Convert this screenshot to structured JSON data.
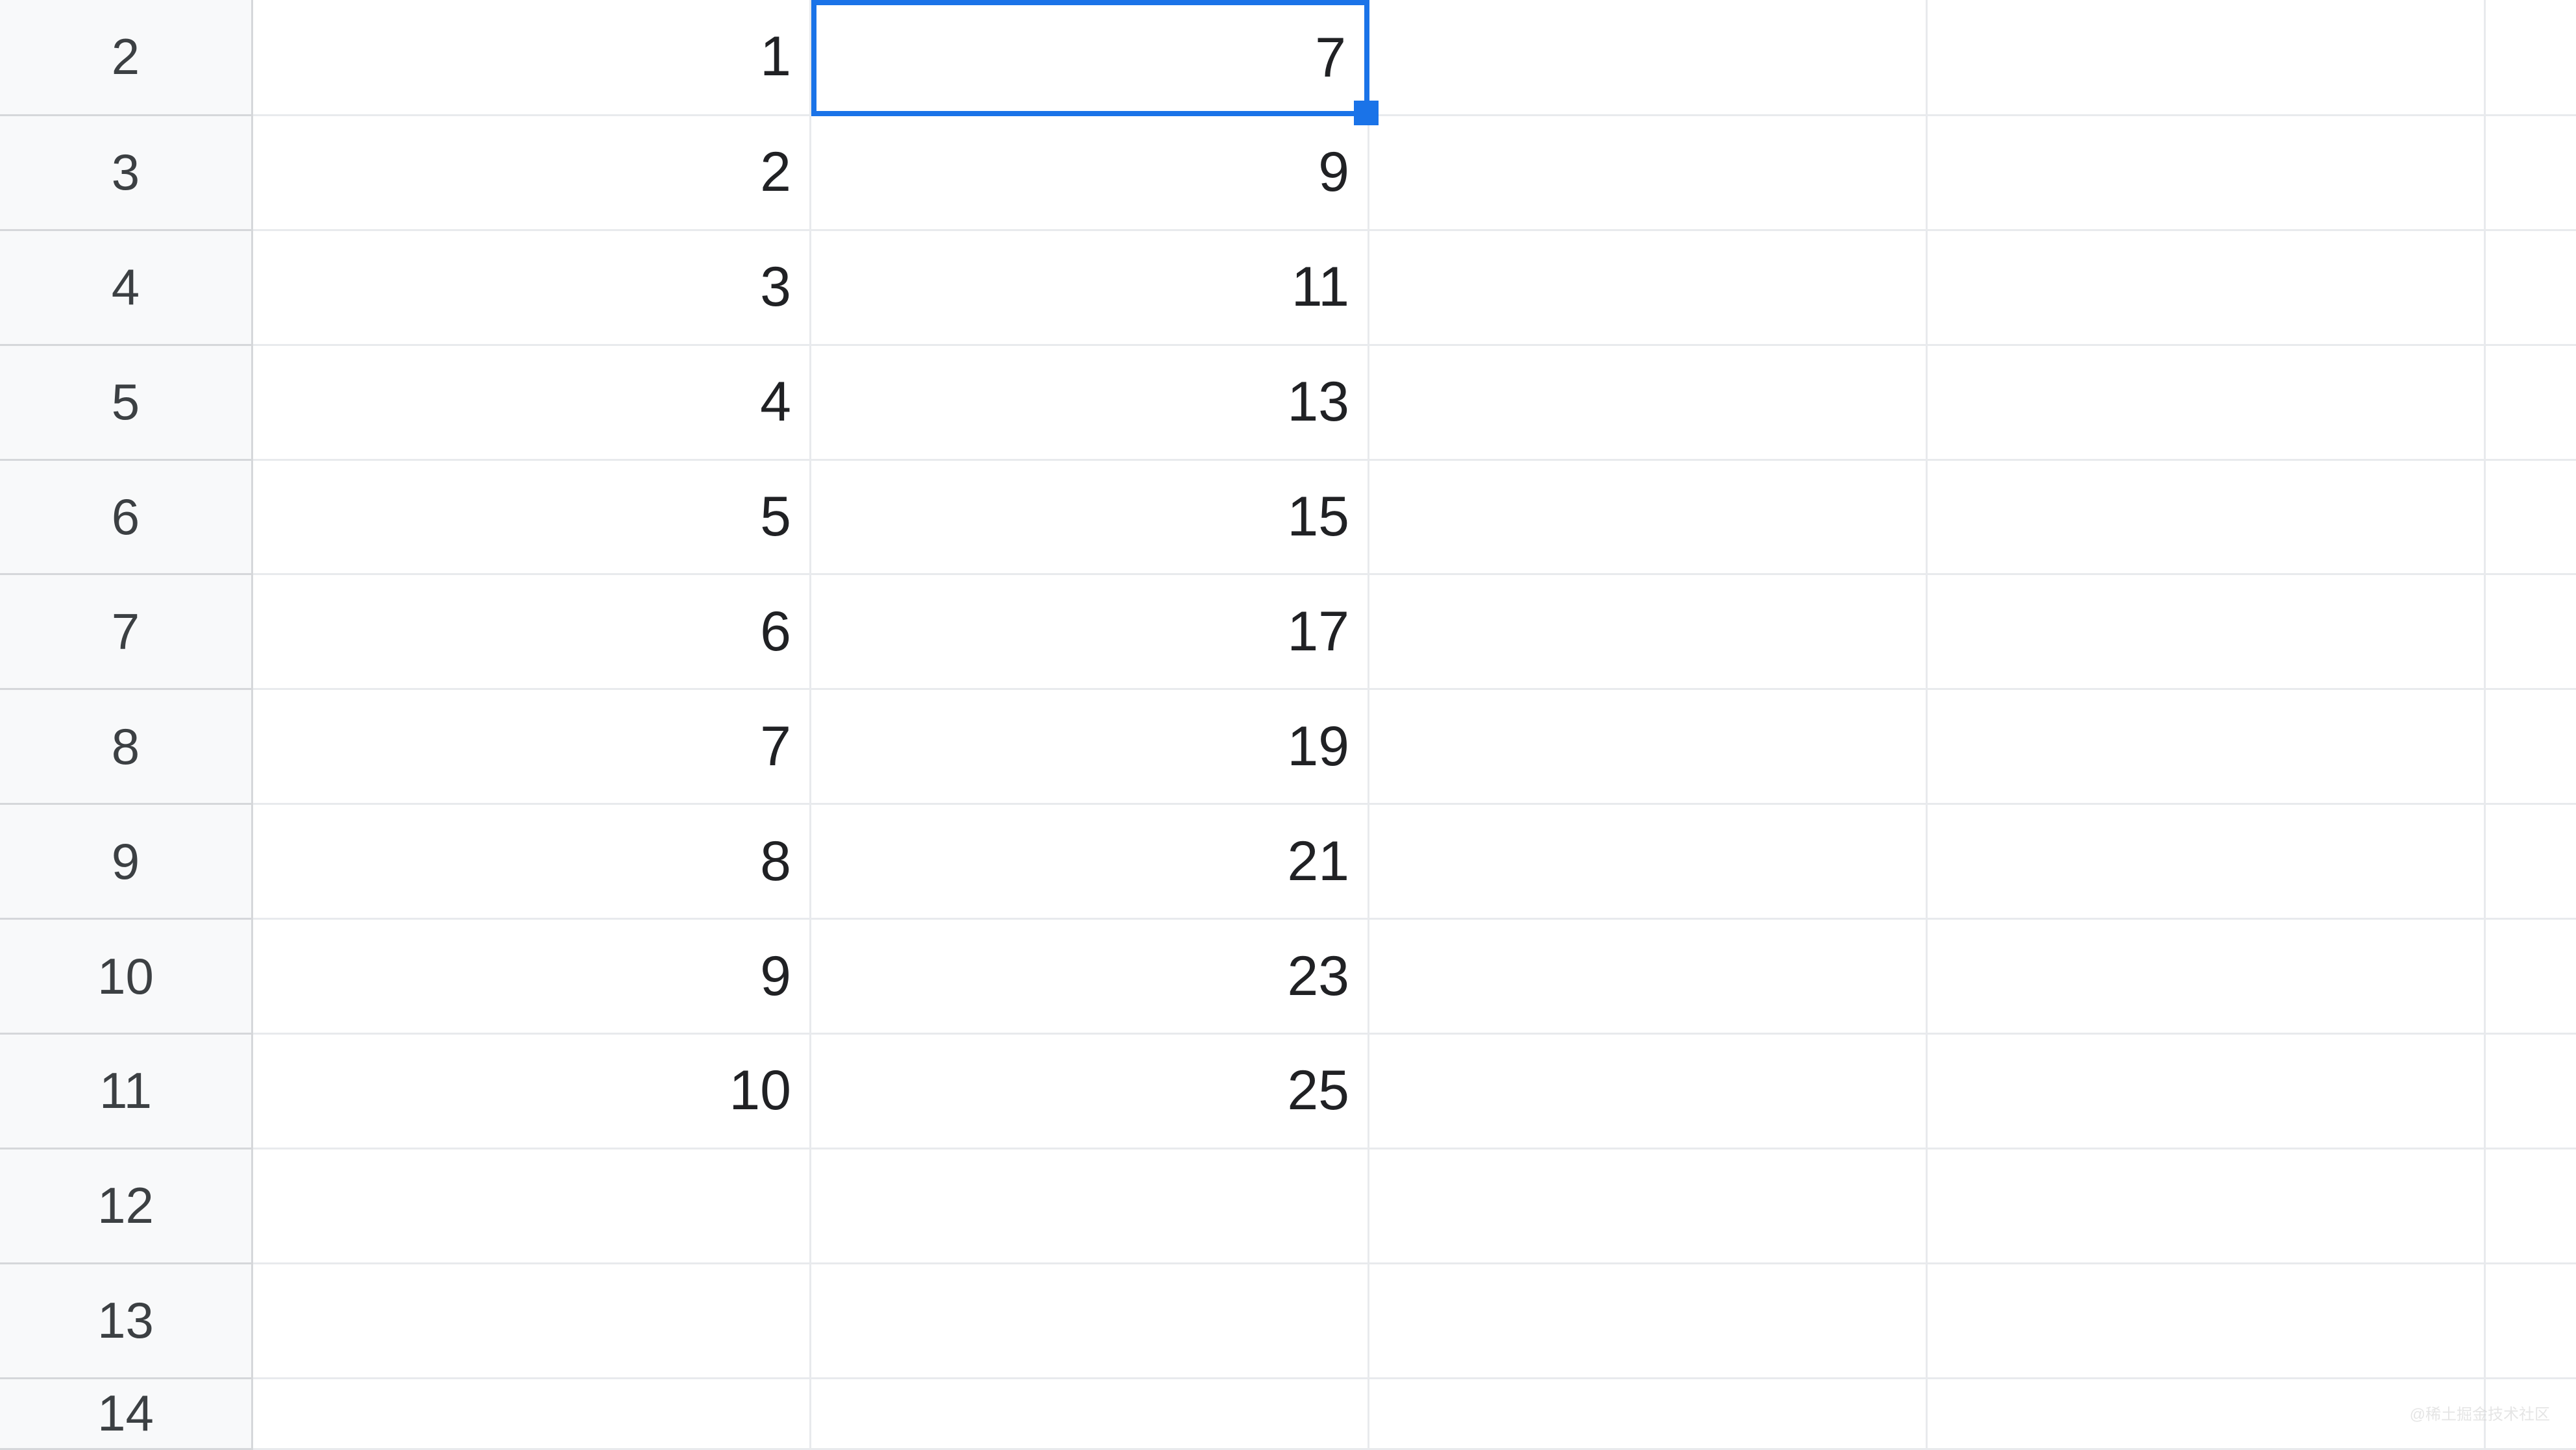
{
  "rowHeaders": [
    "2",
    "3",
    "4",
    "5",
    "6",
    "7",
    "8",
    "9",
    "10",
    "11",
    "12",
    "13",
    "14"
  ],
  "selectedCell": {
    "row": 0,
    "col": 1
  },
  "rows": [
    {
      "a": "1",
      "b": "7",
      "c": "",
      "d": "",
      "e": ""
    },
    {
      "a": "2",
      "b": "9",
      "c": "",
      "d": "",
      "e": ""
    },
    {
      "a": "3",
      "b": "11",
      "c": "",
      "d": "",
      "e": ""
    },
    {
      "a": "4",
      "b": "13",
      "c": "",
      "d": "",
      "e": ""
    },
    {
      "a": "5",
      "b": "15",
      "c": "",
      "d": "",
      "e": ""
    },
    {
      "a": "6",
      "b": "17",
      "c": "",
      "d": "",
      "e": ""
    },
    {
      "a": "7",
      "b": "19",
      "c": "",
      "d": "",
      "e": ""
    },
    {
      "a": "8",
      "b": "21",
      "c": "",
      "d": "",
      "e": ""
    },
    {
      "a": "9",
      "b": "23",
      "c": "",
      "d": "",
      "e": ""
    },
    {
      "a": "10",
      "b": "25",
      "c": "",
      "d": "",
      "e": ""
    },
    {
      "a": "",
      "b": "",
      "c": "",
      "d": "",
      "e": ""
    },
    {
      "a": "",
      "b": "",
      "c": "",
      "d": "",
      "e": ""
    },
    {
      "a": "",
      "b": "",
      "c": "",
      "d": "",
      "e": ""
    }
  ],
  "watermark": "@稀土掘金技术社区"
}
